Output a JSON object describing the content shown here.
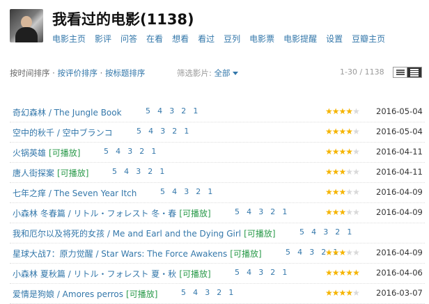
{
  "header": {
    "title": "我看过的电影(1138)",
    "nav": [
      "电影主页",
      "影评",
      "问答",
      "在看",
      "想看",
      "看过",
      "豆列",
      "电影票",
      "电影提醒",
      "设置",
      "豆瓣主页"
    ]
  },
  "toolbar": {
    "sort_time": "按时间排序",
    "sep": "·",
    "sort_rating": "按评价排序",
    "sort_title": "按标题排序",
    "filter_label": "筛选影片: ",
    "filter_value": "全部",
    "pager": "1-30 / 1138"
  },
  "rating_scale": "5 4 3 2 1",
  "playable_tag": "[可播放]",
  "movies": [
    {
      "title": "奇幻森林 / The Jungle Book",
      "playable": false,
      "stars": 4,
      "date": "2016-05-04"
    },
    {
      "title": "空中的秋千 / 空中ブランコ",
      "playable": false,
      "stars": 4,
      "date": "2016-05-04"
    },
    {
      "title": "火锅英雄",
      "playable": true,
      "stars": 4,
      "date": "2016-04-11"
    },
    {
      "title": "唐人街探案",
      "playable": true,
      "stars": 3,
      "date": "2016-04-11"
    },
    {
      "title": "七年之痒 / The Seven Year Itch",
      "playable": false,
      "stars": 3,
      "date": "2016-04-09"
    },
    {
      "title": "小森林 冬春篇 / リトル・フォレスト 冬・春",
      "playable": true,
      "stars": 3,
      "date": "2016-04-09"
    },
    {
      "title": "我和厄尔以及将死的女孩 / Me and Earl and the Dying Girl",
      "playable": true,
      "stars": null,
      "date": ""
    },
    {
      "title": "星球大战7：原力觉醒 / Star Wars: The Force Awakens",
      "playable": true,
      "stars": 3,
      "date": "2016-04-09"
    },
    {
      "title": "小森林 夏秋篇 / リトル・フォレスト 夏・秋",
      "playable": true,
      "stars": 5,
      "date": "2016-04-06"
    },
    {
      "title": "爱情是狗娘 / Amores perros",
      "playable": true,
      "stars": 4,
      "date": "2016-03-07"
    }
  ]
}
